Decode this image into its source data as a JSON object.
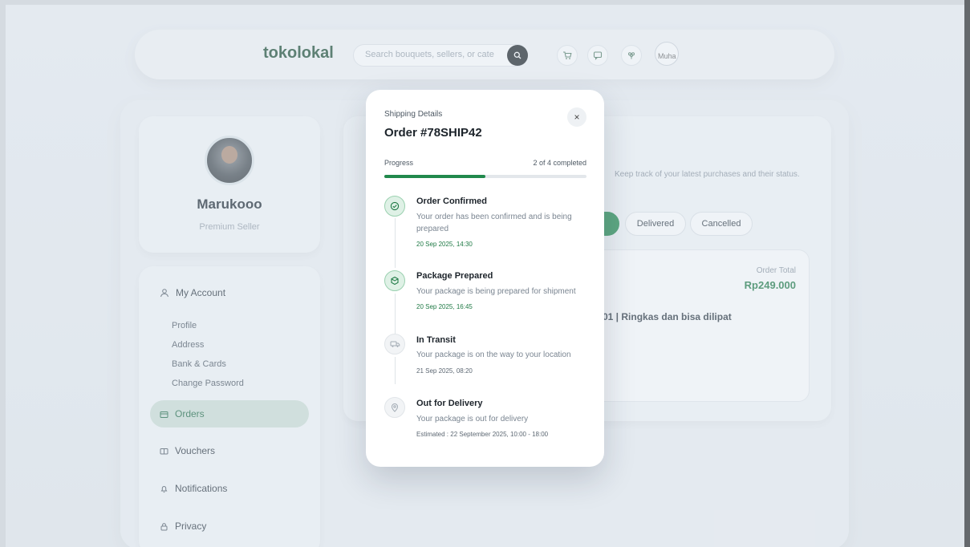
{
  "header": {
    "brand": "tokolokal",
    "search_placeholder": "Search bouquets, sellers, or cate",
    "avatar_alt": "Muha"
  },
  "profile": {
    "name": "Marukooo",
    "role": "Premium Seller"
  },
  "sidebar": {
    "account_label": "My Account",
    "sub_items": [
      "Profile",
      "Address",
      "Bank & Cards",
      "Change Password"
    ],
    "items": [
      {
        "label": "Orders",
        "active": true
      },
      {
        "label": "Vouchers"
      },
      {
        "label": "Notifications"
      },
      {
        "label": "Privacy"
      }
    ]
  },
  "content": {
    "subtitle": "Keep track of your latest purchases and their status.",
    "filters": [
      "d",
      "Delivered",
      "Cancelled"
    ],
    "order_total_label": "Order Total",
    "order_total_value": "Rp249.000",
    "product_text": "01 | Ringkas dan bisa dilipat"
  },
  "modal": {
    "kicker": "Shipping Details",
    "title": "Order #78SHIP42",
    "progress_label": "Progress",
    "progress_count": "2 of 4 completed",
    "progress_fraction": 0.5,
    "close_symbol": "×",
    "steps": [
      {
        "title": "Order Confirmed",
        "desc": "Your order has been confirmed and is being prepared",
        "time": "20 Sep 2025, 14:30",
        "done": true,
        "icon": "check-circle-icon"
      },
      {
        "title": "Package Prepared",
        "desc": "Your package is being prepared for shipment",
        "time": "20 Sep 2025, 16:45",
        "done": true,
        "icon": "box-icon"
      },
      {
        "title": "In Transit",
        "desc": "Your package is on the way to your location",
        "time": "21 Sep 2025, 08:20",
        "done": false,
        "icon": "truck-icon"
      },
      {
        "title": "Out for Delivery",
        "desc": "Your package is out for delivery",
        "time": "Estimated : 22 September 2025, 10:00 - 18:00",
        "done": false,
        "icon": "location-pin-icon"
      }
    ]
  },
  "colors": {
    "accent": "#1f8a4c",
    "brand": "#1f4f37"
  }
}
